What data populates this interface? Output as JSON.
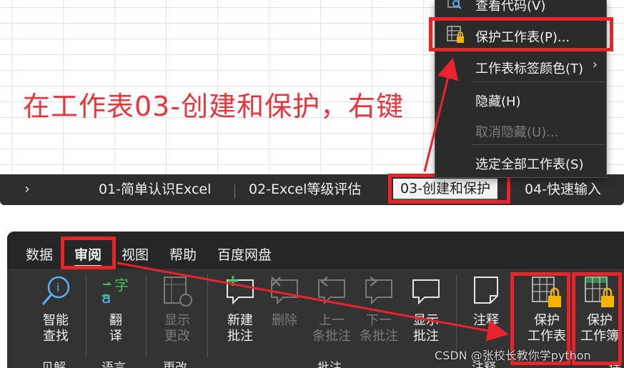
{
  "instruction": "在工作表03-创建和保护，右键",
  "sheet_tabs": {
    "nav": "›",
    "items": [
      "01-简单认识Excel",
      "02-Excel等级评估",
      "03-创建和保护",
      "04-快速输入"
    ],
    "active_index": 2
  },
  "context_menu": {
    "view_code": "查看代码(V)",
    "protect_sheet": "保护工作表(P)...",
    "tab_color": "工作表标签颜色(T)",
    "hide": "隐藏(H)",
    "unhide": "取消隐藏(U)...",
    "select_all": "选定全部工作表(S)"
  },
  "ribbon": {
    "tabs": [
      "数据",
      "审阅",
      "视图",
      "帮助",
      "百度网盘"
    ],
    "active_tab": "审阅",
    "buttons": {
      "smart_lookup": "智能\n查找",
      "translate": "翻\n译",
      "show_changes": "显示\n更改",
      "new_comment": "新建\n批注",
      "delete": "删除",
      "prev_comment": "上一\n条批注",
      "next_comment": "下一\n条批注",
      "show_comments": "显示\n批注",
      "notes": "注释",
      "protect_sheet": "保护\n工作表",
      "protect_workbook": "保护\n工作簿"
    },
    "groups": {
      "insights": "见解",
      "language": "语言",
      "changes": "更改",
      "comments": "批注",
      "notes": "注释",
      "protect": "保"
    }
  },
  "watermark": "CSDN @张校长教你学python",
  "colors": {
    "annotation_red": "#e8232a",
    "ribbon_bg": "#333333",
    "menu_bg": "#2b2b2b"
  }
}
